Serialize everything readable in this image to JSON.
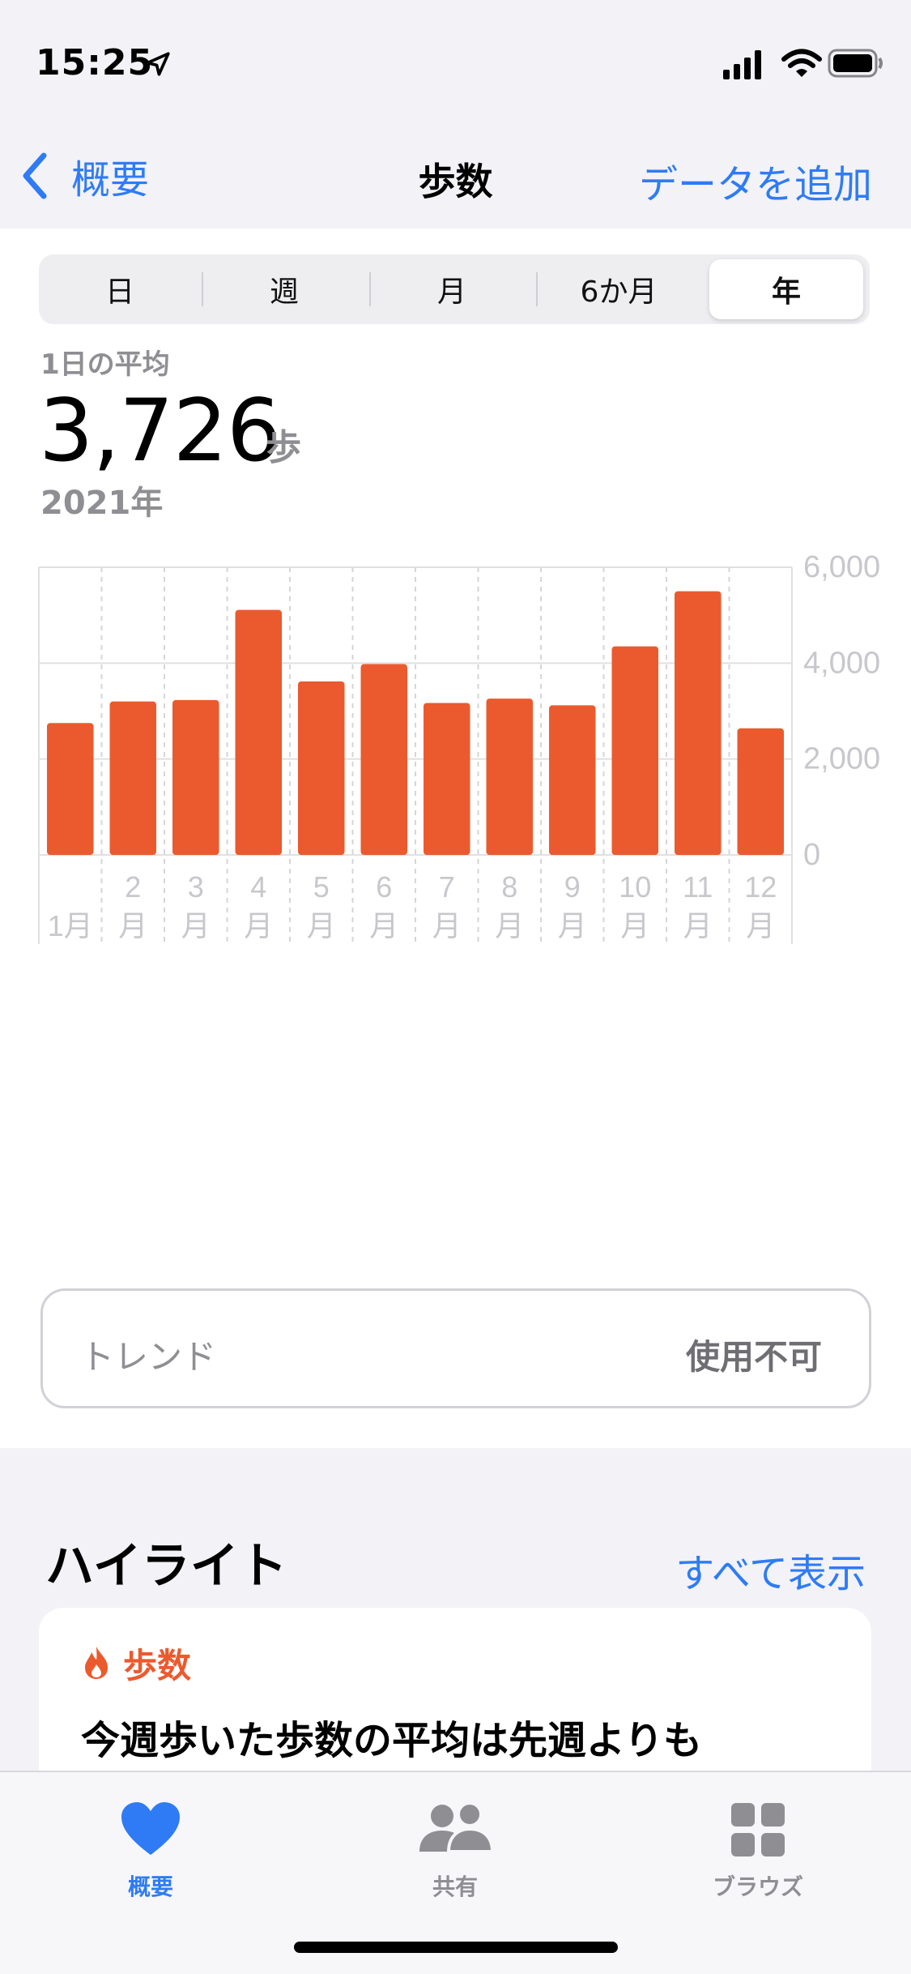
{
  "status_bar": {
    "time": "15:25"
  },
  "nav": {
    "back_label": "概要",
    "title": "歩数",
    "add_label": "データを追加"
  },
  "segments": {
    "items": [
      "日",
      "週",
      "月",
      "6か月",
      "年"
    ],
    "selected": "年"
  },
  "summary": {
    "label": "1日の平均",
    "value": "3,726",
    "unit": "歩",
    "period": "2021年"
  },
  "chart_data": {
    "type": "bar",
    "categories": [
      "1月",
      "2月",
      "3月",
      "4月",
      "5月",
      "6月",
      "7月",
      "8月",
      "9月",
      "10月",
      "11月",
      "12月"
    ],
    "tick_labels": [
      [
        "",
        "1月"
      ],
      [
        "2",
        "月"
      ],
      [
        "3",
        "月"
      ],
      [
        "4",
        "月"
      ],
      [
        "5",
        "月"
      ],
      [
        "6",
        "月"
      ],
      [
        "7",
        "月"
      ],
      [
        "8",
        "月"
      ],
      [
        "9",
        "月"
      ],
      [
        "10",
        "月"
      ],
      [
        "11",
        "月"
      ],
      [
        "12",
        "月"
      ]
    ],
    "values": [
      2750,
      3200,
      3230,
      5110,
      3620,
      3980,
      3170,
      3260,
      3120,
      4350,
      5500,
      2640
    ],
    "ylim": [
      0,
      6000
    ],
    "yticks": [
      0,
      2000,
      4000,
      6000
    ],
    "ytick_labels": [
      "0",
      "2,000",
      "4,000",
      "6,000"
    ],
    "bar_color": "#eb5a2e",
    "grid": true
  },
  "trend": {
    "label": "トレンド",
    "value": "使用不可"
  },
  "highlights": {
    "title": "ハイライト",
    "show_all": "すべて表示",
    "card_category": "歩数",
    "card_text": "今週歩いた歩数の平均は先週よりも"
  },
  "tabbar": {
    "items": [
      {
        "label": "概要",
        "icon": "heart-icon",
        "active": true
      },
      {
        "label": "共有",
        "icon": "people-icon",
        "active": false
      },
      {
        "label": "ブラウズ",
        "icon": "grid-icon",
        "active": false
      }
    ]
  },
  "colors": {
    "accent": "#2f7bf5",
    "bar": "#eb5a2e",
    "secondary_text": "#8e8e93"
  }
}
